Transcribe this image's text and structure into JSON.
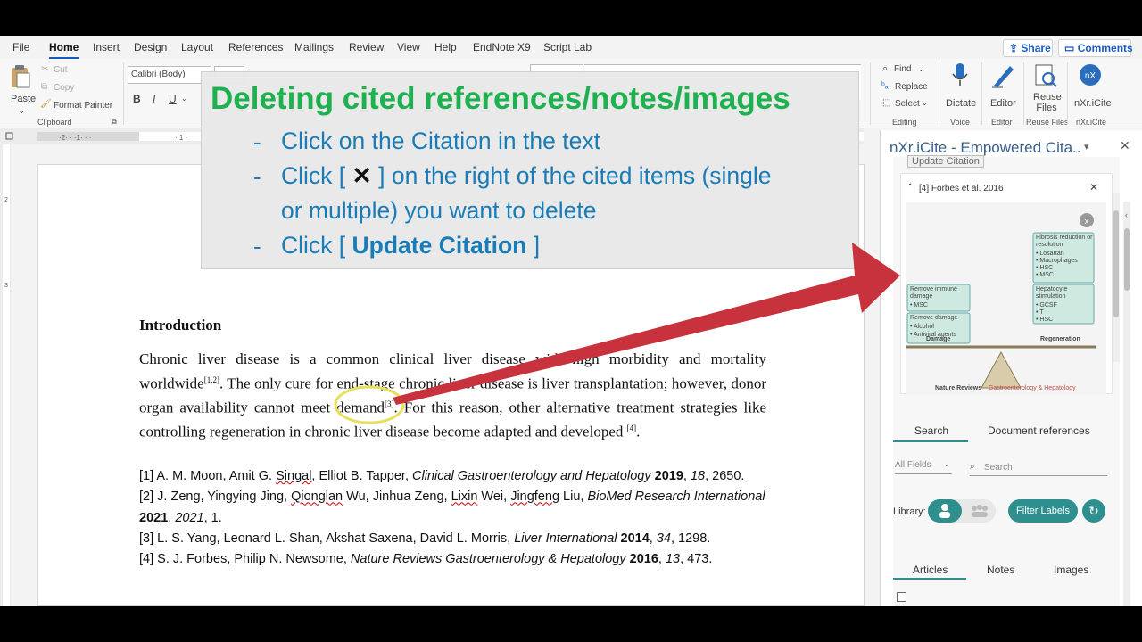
{
  "menu": {
    "tabs": [
      "File",
      "Home",
      "Insert",
      "Design",
      "Layout",
      "References",
      "Mailings",
      "Review",
      "View",
      "Help",
      "EndNote X9",
      "Script Lab"
    ],
    "active_tab": "Home",
    "share": "Share",
    "comments": "Comments"
  },
  "ribbon": {
    "paste": "Paste",
    "cut": "Cut",
    "copy": "Copy",
    "format_painter": "Format Painter",
    "clipboard": "Clipboard",
    "font_name": "Calibri (Body)",
    "bold": "B",
    "italic": "I",
    "underline": "U",
    "find": "Find",
    "replace": "Replace",
    "select": "Select",
    "editing": "Editing",
    "dictate": "Dictate",
    "voice": "Voice",
    "editor": "Editor",
    "editor_group": "Editor",
    "reuse_files": "Reuse Files",
    "reuse_group": "Reuse Files",
    "nxr": "nXr.iCite",
    "nxr_group": "nXr.iCite"
  },
  "document": {
    "heading": "Introduction",
    "p1": "Chronic liver disease is a common clinical liver disease with high morbidity and mortality worldwide",
    "cite1": "[1,2]",
    "p2": ". The only cure for end-stage chronic liver disease is liver transplantation; however, donor organ availability cannot meet demand",
    "cite2": "[3]",
    "p3": ". For this reason, other alternative treatment strategies like controlling regeneration in chronic liver disease become adapted and developed ",
    "cite3": "[4]",
    "p4": ".",
    "references": [
      {
        "pre": "[1] A. M. Moon, Amit G. ",
        "u1": "Singal",
        "mid": ", Elliot B. Tapper, ",
        "journal": "Clinical Gastroenterology and Hepatology",
        "year": "2019",
        "vol": "18",
        "pages": "2650."
      },
      {
        "pre": "[2] J. Zeng, Yingying Jing, ",
        "u1": "Qionglan",
        "mid": " Wu, Jinhua Zeng, ",
        "u2": "Lixin",
        "mid2": " Wei, ",
        "u3": "Jingfeng",
        "mid3": " Liu, ",
        "journal": "BioMed Research International",
        "year": "2021",
        "vol": "2021",
        "pages": "1."
      },
      {
        "pre": "[3] L. S. Yang, Leonard L. Shan, Akshat Saxena, David L. Morris, ",
        "journal": "Liver International",
        "year": "2014",
        "vol": "34",
        "pages": "1298."
      },
      {
        "pre": "[4] S. J. Forbes, Philip N. Newsome, ",
        "journal": "Nature Reviews Gastroenterology & Hepatology",
        "year": "2016",
        "vol": "13",
        "pages": "473."
      }
    ]
  },
  "tutorial": {
    "title": "Deleting cited references/notes/images",
    "step1": "Click on the Citation in the text",
    "step2_a": "Click [",
    "step2_b": "] on the right of the cited items (single",
    "step2_c": "or multiple) you want to delete",
    "step3_a": "Click [",
    "step3_b": "Update Citation",
    "step3_c": "]"
  },
  "panel": {
    "title": "nXr.iCite - Empowered Cita..",
    "update_citation": "Update Citation",
    "cited_item": "[4] Forbes et al. 2016",
    "figure": {
      "box1_title": "Remove immune damage",
      "box1_item": "• MSC",
      "box2_title": "Remove damage",
      "box2_items": [
        "• Alcohol",
        "• Antiviral agents"
      ],
      "box3_title": "Fibrosis reduction or resolution",
      "box3_items": [
        "• Losartan",
        "• Macrophages",
        "• HSC",
        "• MSC"
      ],
      "box4_title": "Hepatocyte stimulation",
      "box4_items": [
        "• GCSF",
        "• T",
        "• HSC"
      ],
      "damage": "Damage",
      "regeneration": "Regeneration",
      "source_a": "Nature Reviews",
      "source_b": "Gastroenterology & Hepatology"
    },
    "tab_search": "Search",
    "tab_docrefs": "Document references",
    "all_fields": "All Fields",
    "search_placeholder": "Search",
    "library": "Library:",
    "filter_labels": "Filter Labels",
    "subtab_articles": "Articles",
    "subtab_notes": "Notes",
    "subtab_images": "Images"
  },
  "colors": {
    "accent": "#185abd",
    "title_green": "#1fb050",
    "step_blue": "#1a7cb6",
    "arrow": "#c8323c",
    "teal": "#2f8f8f"
  }
}
